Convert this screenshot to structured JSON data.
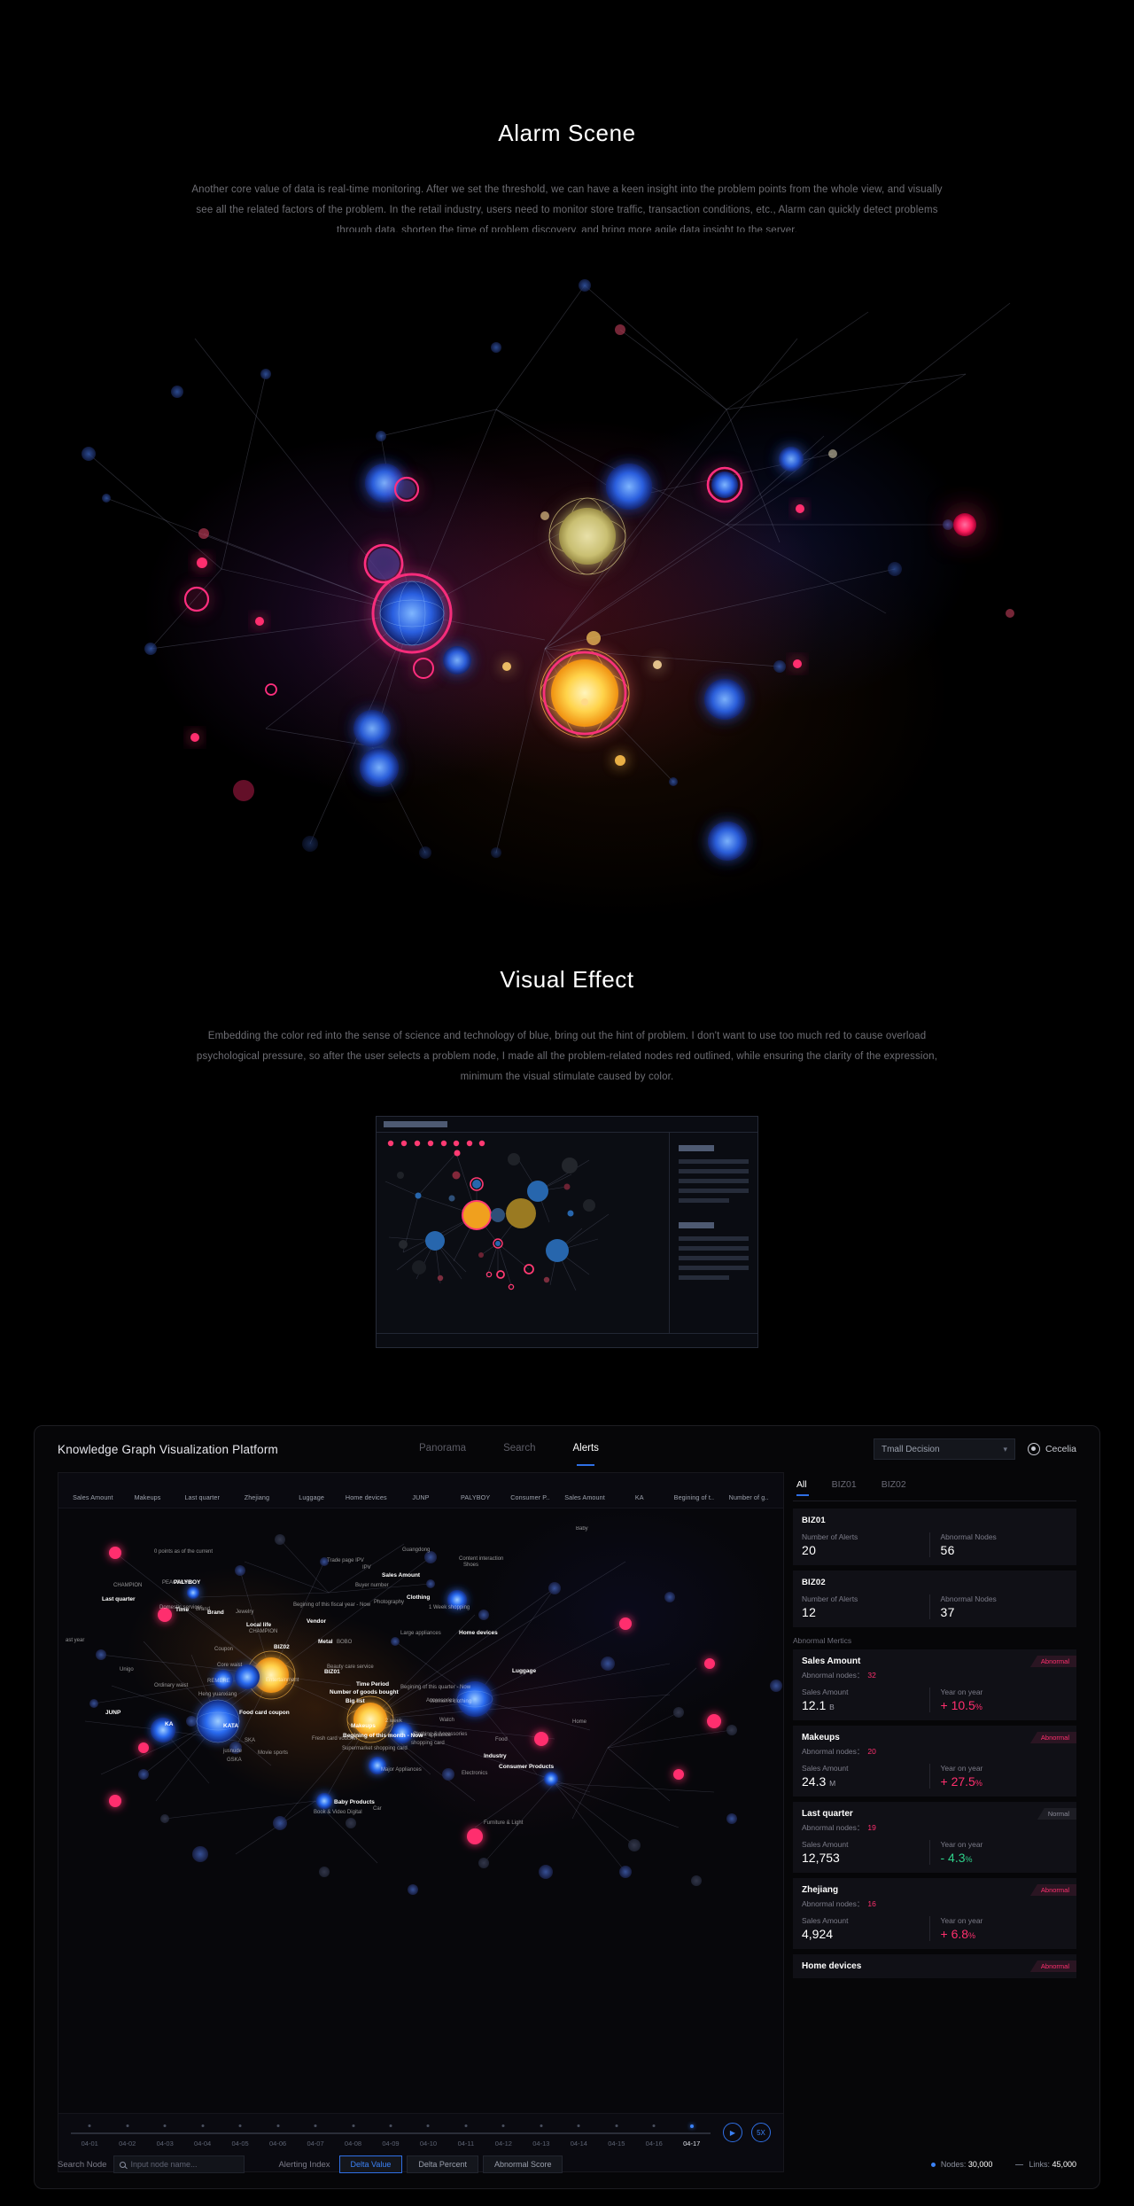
{
  "sections": {
    "alarm": {
      "title": "Alarm Scene",
      "desc": "Another core value of data is real-time monitoring. After we set the threshold, we can have a keen insight into the problem points from the whole view, and visually see all the related factors of the problem. In the retail industry, users need to monitor store traffic, transaction conditions, etc., Alarm can quickly detect problems through data, shorten the time of problem discovery, and bring more agile data insight to the server."
    },
    "visual": {
      "title": "Visual Effect",
      "desc": "Embedding the color red into the sense of science and technology of blue, bring out the hint of problem. I don't want to use too much red to cause overload psychological pressure, so after the user selects a problem node, I made all the problem-related nodes red outlined, while ensuring the clarity of the expression, minimum the visual stimulate caused by color."
    }
  },
  "dashboard": {
    "brand": "Knowledge Graph Visualization Platform",
    "nav": [
      {
        "label": "Panorama",
        "active": false
      },
      {
        "label": "Search",
        "active": false
      },
      {
        "label": "Alerts",
        "active": true
      }
    ],
    "workspace_select": {
      "value": "Tmall Decision",
      "chevron": "chevron-down-icon"
    },
    "user": {
      "name": "Cecelia",
      "avatar_icon": "user-avatar-icon"
    },
    "chips": [
      "Sales Amount",
      "Makeups",
      "Last quarter",
      "Zhejiang",
      "Luggage",
      "Home devices",
      "JUNP",
      "PALYBOY",
      "Consumer P..",
      "Sales Amount",
      "KA",
      "Begining of t..",
      "Number of g.."
    ],
    "timeline": {
      "dates": [
        "04-01",
        "04-02",
        "04-03",
        "04-04",
        "04-05",
        "04-06",
        "04-07",
        "04-08",
        "04-09",
        "04-10",
        "04-11",
        "04-12",
        "04-13",
        "04-14",
        "04-15",
        "04-16",
        "04-17"
      ],
      "current": "04-17",
      "play_icon": "play-icon",
      "speed": "5X"
    },
    "bottom": {
      "search_label": "Search Node",
      "search_placeholder": "Input node name...",
      "search_icon": "search-icon",
      "alerting_label": "Alerting Index",
      "segments": [
        {
          "label": "Delta Value",
          "active": true
        },
        {
          "label": "Delta Percent",
          "active": false
        },
        {
          "label": "Abnormal Score",
          "active": false
        }
      ],
      "legend": [
        {
          "label": "Nodes:",
          "value": "30,000",
          "marker": "dot"
        },
        {
          "label": "Links:",
          "value": "45,000",
          "marker": "line"
        }
      ]
    },
    "side": {
      "tabs": [
        {
          "label": "All",
          "active": true
        },
        {
          "label": "BIZ01",
          "active": false
        },
        {
          "label": "BIZ02",
          "active": false
        }
      ],
      "biz_cards": [
        {
          "name": "BIZ01",
          "kpis": [
            {
              "key": "Number of  Alerts",
              "value": "20"
            },
            {
              "key": "Abnormal Nodes",
              "value": "56"
            }
          ]
        },
        {
          "name": "BIZ02",
          "kpis": [
            {
              "key": "Number of  Alerts",
              "value": "12"
            },
            {
              "key": "Abnormal Nodes",
              "value": "37"
            }
          ]
        }
      ],
      "metrics_title": "Abnormal Mertics",
      "metrics": [
        {
          "title": "Sales Amount",
          "badge": "Abnormal",
          "badge_state": "abnormal",
          "abnormal_label": "Abnormal nodes：",
          "abnormal_nodes": "32",
          "amount_label": "Sales Amount",
          "amount_value": "12.1",
          "amount_unit": "B",
          "yoy_label": "Year on year",
          "yoy_value": "+ 10.5",
          "yoy_unit": "%",
          "yoy_dir": "up"
        },
        {
          "title": "Makeups",
          "badge": "Abnormal",
          "badge_state": "abnormal",
          "abnormal_label": "Abnormal nodes：",
          "abnormal_nodes": "20",
          "amount_label": "Sales Amount",
          "amount_value": "24.3",
          "amount_unit": "M",
          "yoy_label": "Year on year",
          "yoy_value": "+ 27.5",
          "yoy_unit": "%",
          "yoy_dir": "up"
        },
        {
          "title": "Last quarter",
          "badge": "Normal",
          "badge_state": "normal",
          "abnormal_label": "Abnormal nodes：",
          "abnormal_nodes": "19",
          "amount_label": "Sales Amount",
          "amount_value": "12,753",
          "amount_unit": "",
          "yoy_label": "Year on year",
          "yoy_value": "- 4.3",
          "yoy_unit": "%",
          "yoy_dir": "down"
        },
        {
          "title": "Zhejiang",
          "badge": "Abnormal",
          "badge_state": "abnormal",
          "abnormal_label": "Abnormal nodes：",
          "abnormal_nodes": "16",
          "amount_label": "Sales Amount",
          "amount_value": "4,924",
          "amount_unit": "",
          "yoy_label": "Year on year",
          "yoy_value": "+ 6.8",
          "yoy_unit": "%",
          "yoy_dir": "up"
        },
        {
          "title": "Home devices",
          "badge": "Abnormal",
          "badge_state": "abnormal",
          "abnormal_label": "",
          "abnormal_nodes": "",
          "amount_label": "",
          "amount_value": "",
          "amount_unit": "",
          "yoy_label": "",
          "yoy_value": "",
          "yoy_unit": "",
          "yoy_dir": "up"
        }
      ]
    },
    "graph_labels": [
      "0 points as of the current",
      "Last quarter",
      "ast year",
      "Time",
      "Guangdong",
      "Content interaction",
      "Home devices",
      "BOBO",
      "Large appliances",
      "Beauty care service",
      "REMERE",
      "Heng yuanxiang",
      "jusnude",
      "Movie sports",
      "Supermarket shopping card",
      "Book appliance shopping card",
      "BIZ02",
      "CHAMPION",
      "PEACEBIRD",
      "PALYBOY",
      "Domestic services",
      "Coupon",
      "Core waist",
      "Unigo",
      "Ordinary waist",
      "JUNP",
      "Food card coupon",
      "KATA",
      "KA",
      "SKA",
      "GSKA",
      "Brand",
      "Local life",
      "Vendor",
      "Photography",
      "Accessories",
      "Watch",
      "Entertainment",
      "Fresh card voucher",
      "Jewelry",
      "Number of goods bought",
      "Metal",
      "BIZ01",
      "Big list",
      "Baby Products",
      "Time Period",
      "Begining of this fiscal year - Now",
      "Buyer number",
      "Clothing",
      "1 Week shopping",
      "Sales Amount",
      "Shoes",
      "IPV",
      "Trade page IPV",
      "Luggage",
      "Begining of this quarter - Now",
      "Women's clothing",
      "2 week",
      "Clothing & Accessories",
      "Makeups",
      "Begining of this month - Now",
      "Industry",
      "Food",
      "Consumer Products",
      "Electronics",
      "Major Appliances",
      "Car",
      "Book & Video Digital",
      "Furniture & Light",
      "Baby",
      "Home"
    ]
  }
}
